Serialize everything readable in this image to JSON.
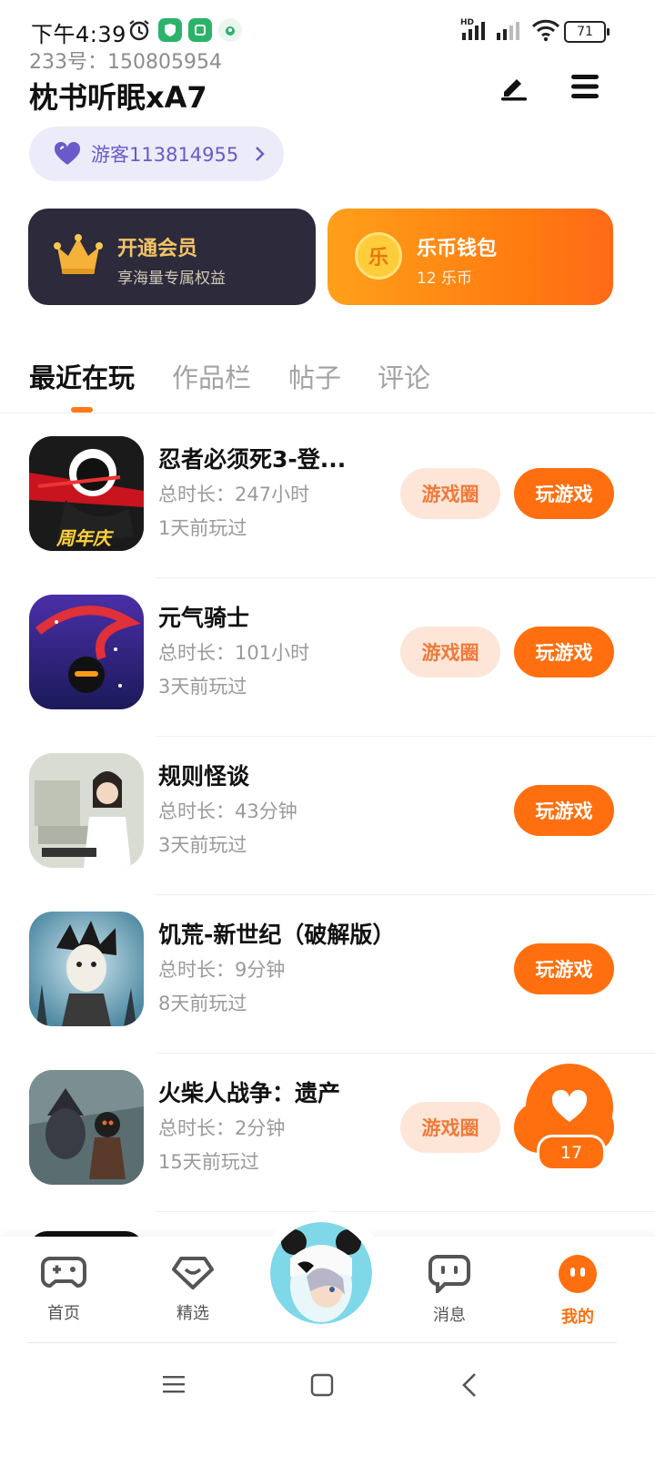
{
  "status_bar": {
    "time": "下午4:39",
    "battery": "71",
    "network_badge": "HD"
  },
  "header": {
    "id_line": "233号：150805954",
    "username": "枕书听眠xA7",
    "guest_label": "游客113814955"
  },
  "cards": {
    "vip": {
      "title": "开通会员",
      "subtitle": "享海量专属权益"
    },
    "wallet": {
      "title": "乐币钱包",
      "subtitle": "12 乐币",
      "coin_glyph": "乐"
    }
  },
  "tabs": [
    {
      "label": "最近在玩"
    },
    {
      "label": "作品栏"
    },
    {
      "label": "帖子"
    },
    {
      "label": "评论"
    }
  ],
  "games": [
    {
      "title": "忍者必须死3-登...",
      "duration": "总时长：247小时",
      "last_played": "1天前玩过",
      "circle_label": "游戏圈",
      "play_label": "玩游戏",
      "icon_caption": "周年庆"
    },
    {
      "title": "元气骑士",
      "duration": "总时长：101小时",
      "last_played": "3天前玩过",
      "circle_label": "游戏圈",
      "play_label": "玩游戏"
    },
    {
      "title": "规则怪谈",
      "duration": "总时长：43分钟",
      "last_played": "3天前玩过",
      "play_label": "玩游戏"
    },
    {
      "title": "饥荒-新世纪（破解版）",
      "duration": "总时长：9分钟",
      "last_played": "8天前玩过",
      "play_label": "玩游戏"
    },
    {
      "title": "火柴人战争：遗产",
      "duration": "总时长：2分钟",
      "last_played": "15天前玩过",
      "circle_label": "游戏圈"
    }
  ],
  "floating_like": {
    "count": "17"
  },
  "bottom_nav": {
    "items": [
      {
        "label": "首页"
      },
      {
        "label": "精选"
      },
      {
        "label": "消息"
      },
      {
        "label": "我的"
      }
    ]
  },
  "colors": {
    "accent": "#ff6f0f",
    "guest_purple": "#6a5ac9",
    "vip_dark": "#2c2a3b",
    "vip_gold": "#f3c467"
  }
}
